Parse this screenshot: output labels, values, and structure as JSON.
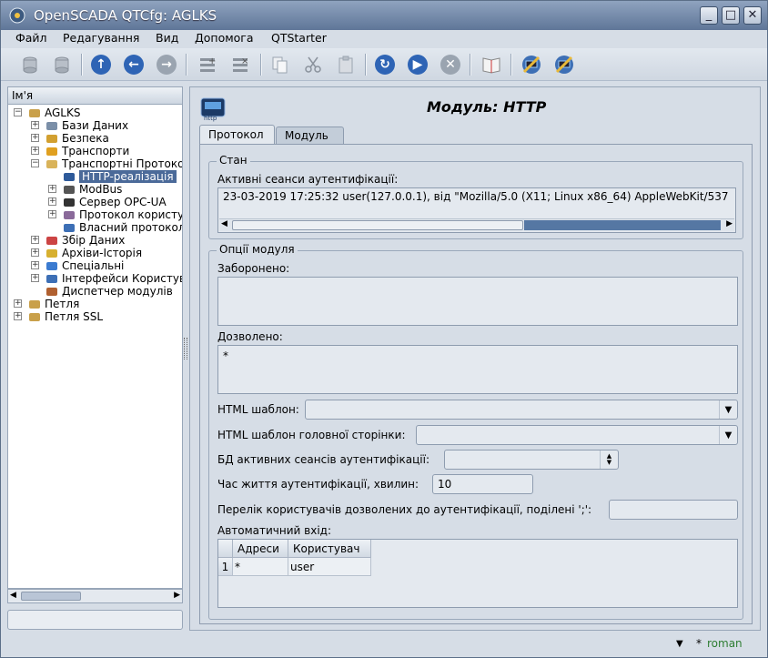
{
  "window": {
    "title": "OpenSCADA QTCfg: AGLKS"
  },
  "menu": {
    "items": [
      "Файл",
      "Редагування",
      "Вид",
      "Допомога",
      "QTStarter"
    ]
  },
  "toolbar": {
    "icons": [
      "db-load-icon",
      "db-save-icon",
      "up-icon",
      "back-icon",
      "forward-icon",
      "add-item-icon",
      "delete-item-icon",
      "copy-icon",
      "cut-icon",
      "paste-icon",
      "refresh-icon",
      "start-icon",
      "stop-icon",
      "manual-icon",
      "config-icon-1",
      "config-icon-2"
    ]
  },
  "tree": {
    "header": "Ім'я",
    "items": [
      {
        "label": "AGLKS",
        "level": 0,
        "expander": "−",
        "icon": "folder"
      },
      {
        "label": "Бази Даних",
        "level": 1,
        "expander": "+",
        "icon": "db"
      },
      {
        "label": "Безпека",
        "level": 1,
        "expander": "+",
        "icon": "security"
      },
      {
        "label": "Транспорти",
        "level": 1,
        "expander": "+",
        "icon": "transport"
      },
      {
        "label": "Транспортні Протоколи",
        "level": 1,
        "expander": "−",
        "icon": "folder-open"
      },
      {
        "label": "HTTP-реалізація",
        "level": 2,
        "expander": "",
        "icon": "http",
        "selected": true
      },
      {
        "label": "ModBus",
        "level": 2,
        "expander": "+",
        "icon": "modbus"
      },
      {
        "label": "Сервер OPC-UA",
        "level": 2,
        "expander": "+",
        "icon": "opcua"
      },
      {
        "label": "Протокол користувача",
        "level": 2,
        "expander": "+",
        "icon": "user-protocol"
      },
      {
        "label": "Власний протокол",
        "level": 2,
        "expander": "",
        "icon": "self-protocol"
      },
      {
        "label": "Збір Даних",
        "level": 1,
        "expander": "+",
        "icon": "daq"
      },
      {
        "label": "Архіви-Історія",
        "level": 1,
        "expander": "+",
        "icon": "archive"
      },
      {
        "label": "Спеціальні",
        "level": 1,
        "expander": "+",
        "icon": "special"
      },
      {
        "label": "Інтерфейси Користувача",
        "level": 1,
        "expander": "+",
        "icon": "ui"
      },
      {
        "label": "Диспетчер модулів",
        "level": 1,
        "expander": "",
        "icon": "modsched"
      },
      {
        "label": "Петля",
        "level": 0,
        "expander": "+",
        "icon": "folder"
      },
      {
        "label": "Петля SSL",
        "level": 0,
        "expander": "+",
        "icon": "folder"
      }
    ]
  },
  "page": {
    "title": "Модуль: HTTP",
    "tabs": [
      "Протокол",
      "Модуль"
    ],
    "state": {
      "group_title": "Стан",
      "sessions_label": "Активні сеанси аутентифікації:",
      "sessions_value": "23-03-2019 17:25:32 user(127.0.0.1), від \"Mozilla/5.0 (X11; Linux x86_64) AppleWebKit/537"
    },
    "options": {
      "group_title": "Опції модуля",
      "denied_label": "Заборонено:",
      "denied_value": "",
      "allowed_label": "Дозволено:",
      "allowed_value": "*",
      "html_template_label": "HTML шаблон:",
      "html_template_value": "",
      "main_page_template_label": "HTML шаблон головної сторінки:",
      "main_page_template_value": "",
      "sessions_db_label": "БД активних сеансів аутентифікації:",
      "sessions_db_value": "",
      "auth_lifetime_label": "Час життя аутентифікації, хвилин:",
      "auth_lifetime_value": "10",
      "allowed_users_label": "Перелік користувачів дозволених до аутентифікації, поділені ';':",
      "allowed_users_value": "",
      "autologin_label": "Автоматичний вхід:",
      "autologin_table": {
        "columns": [
          "Адреси",
          "Користувач"
        ],
        "rows": [
          {
            "num": "1",
            "address": "*",
            "user": "user"
          }
        ]
      }
    }
  },
  "statusbar": {
    "modified": "*",
    "user": "roman"
  },
  "colors": {
    "selection": "#4b6a99",
    "user_text": "#2e7d32"
  }
}
